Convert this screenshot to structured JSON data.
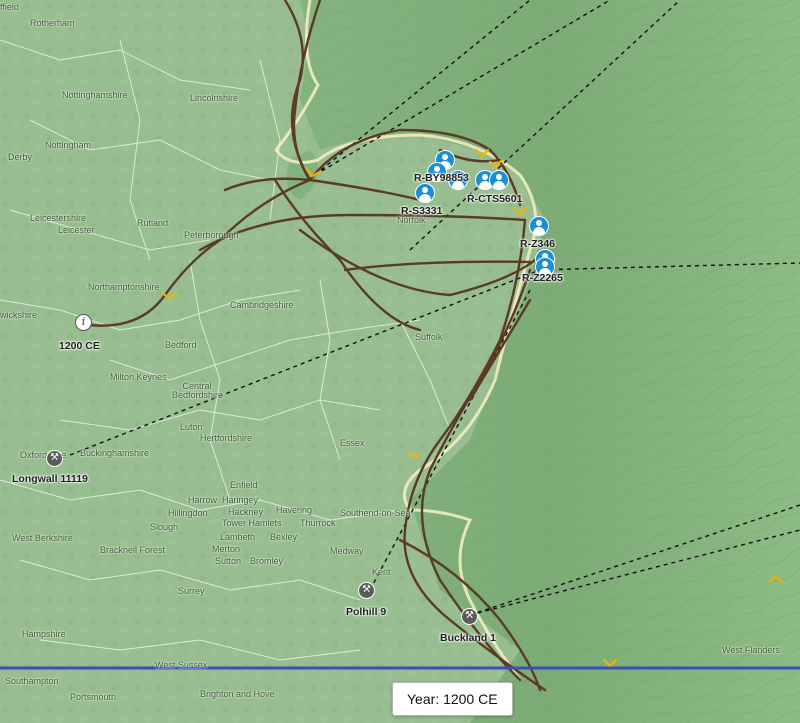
{
  "map": {
    "places": [
      {
        "name": "Rotherham"
      },
      {
        "name": "ffield"
      },
      {
        "name": "Nottinghamshire"
      },
      {
        "name": "Lincolnshire"
      },
      {
        "name": "Nottingham"
      },
      {
        "name": "Derby"
      },
      {
        "name": "Leicestershire"
      },
      {
        "name": "Leicester"
      },
      {
        "name": "Rutland"
      },
      {
        "name": "Peterborough"
      },
      {
        "name": "Norfolk"
      },
      {
        "name": "Northamptonshire"
      },
      {
        "name": "Cambridgeshire"
      },
      {
        "name": "wickshire"
      },
      {
        "name": "Bedford"
      },
      {
        "name": "Suffolk"
      },
      {
        "name": "Milton Keynes"
      },
      {
        "name": "Central Bedfordshire"
      },
      {
        "name": "Luton"
      },
      {
        "name": "Hertfordshire"
      },
      {
        "name": "Buckinghamshire"
      },
      {
        "name": "Oxfordshire"
      },
      {
        "name": "Essex"
      },
      {
        "name": "Enfield"
      },
      {
        "name": "Harrow"
      },
      {
        "name": "Haringey"
      },
      {
        "name": "Hackney"
      },
      {
        "name": "Hillingdon"
      },
      {
        "name": "Tower Hamlets"
      },
      {
        "name": "Havering"
      },
      {
        "name": "Southend-on-Sea"
      },
      {
        "name": "Thurrock"
      },
      {
        "name": "Slough"
      },
      {
        "name": "West Berkshire"
      },
      {
        "name": "Bracknell Forest"
      },
      {
        "name": "Lambeth"
      },
      {
        "name": "Bexley"
      },
      {
        "name": "Merton"
      },
      {
        "name": "Sutton"
      },
      {
        "name": "Bromley"
      },
      {
        "name": "Medway"
      },
      {
        "name": "Kent"
      },
      {
        "name": "Surrey"
      },
      {
        "name": "Hampshire"
      },
      {
        "name": "West Sussex"
      },
      {
        "name": "Southampton"
      },
      {
        "name": "Portsmouth"
      },
      {
        "name": "Brighton and Hove"
      },
      {
        "name": "West Flanders"
      }
    ],
    "people": [
      {
        "label": "R-BY98853"
      },
      {
        "label": "R-S3331"
      },
      {
        "label": "R-CTS5601"
      },
      {
        "label": "R-Z346"
      },
      {
        "label": "R-Z2265"
      }
    ],
    "sites": [
      {
        "label": "Longwall 11119",
        "icon": "shovel-icon"
      },
      {
        "label": "Polhill 9",
        "icon": "shovel-icon"
      },
      {
        "label": "Buckland 1",
        "icon": "shovel-icon"
      }
    ],
    "origin": {
      "label": "1200 CE",
      "icon": "origin-marker-icon",
      "symbol": "i"
    },
    "colors": {
      "land": "#8fb88a",
      "sea": "#7fb07a",
      "migration_path": "#5b3a26",
      "arrow": "#f0b400",
      "coastline": "#f2efc0",
      "boundary": "#e9f3e6",
      "person_marker": "#1a8fd6",
      "site_marker": "#5b5b5b",
      "timeline": "#3a4fb8"
    }
  },
  "footer": {
    "year_label": "Year: 1200 CE"
  }
}
